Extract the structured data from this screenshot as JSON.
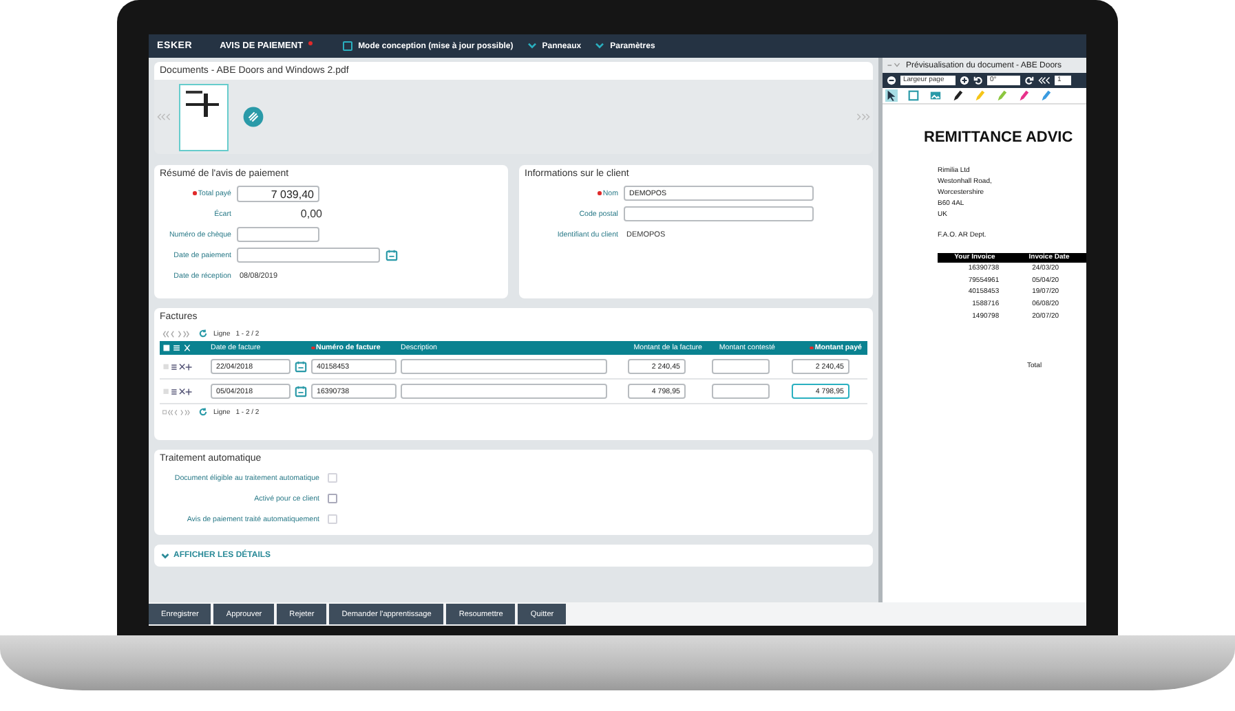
{
  "topbar": {
    "logo": "ESKER",
    "title": "AVIS DE PAIEMENT",
    "required": true,
    "design_mode": {
      "label": "Mode conception (mise à jour possible)",
      "checked": false
    },
    "menus": [
      {
        "label": "Panneaux"
      },
      {
        "label": "Paramètres"
      }
    ]
  },
  "documents": {
    "title": "Documents - ABE Doors and Windows 2.pdf"
  },
  "summary": {
    "title": "Résumé de l'avis de paiement",
    "fields": [
      {
        "kind": "amount",
        "label": "Total payé",
        "required": true,
        "value": "7 039,40"
      },
      {
        "kind": "total",
        "label": "Écart",
        "value": "0,00"
      },
      {
        "kind": "input",
        "label": "Numéro de chèque",
        "required": false
      },
      {
        "kind": "date",
        "label": "Date de paiement",
        "required": false
      },
      {
        "kind": "text",
        "label": "Date de réception",
        "value": "08/08/2019"
      }
    ]
  },
  "client": {
    "title": "Informations sur le client",
    "fields": [
      {
        "kind": "input",
        "label": "Nom",
        "required": true,
        "value": "DEMOPOS"
      },
      {
        "kind": "input",
        "label": "Code postal",
        "required": false
      },
      {
        "kind": "text",
        "label": "Identifiant du client",
        "value": "DEMOPOS"
      }
    ]
  },
  "invoices": {
    "title": "Factures",
    "pager_top": {
      "label": "Ligne",
      "range": "1 - 2 / 2"
    },
    "columns": [
      {
        "label": "Date de facture",
        "required": false
      },
      {
        "label": "Numéro de facture",
        "required": true
      },
      {
        "label": "Description",
        "required": false
      },
      {
        "label": "Montant de la facture",
        "required": false
      },
      {
        "label": "Montant contesté",
        "required": false
      },
      {
        "label": "Montant payé",
        "required": true
      }
    ],
    "rows": [
      {
        "date": "22/04/2018",
        "number": "40158453",
        "amount": "2 240,45",
        "paid": "2 240,45",
        "focused": false
      },
      {
        "date": "05/04/2018",
        "number": "16390738",
        "amount": "4 798,95",
        "paid": "4 798,95",
        "focused": true
      }
    ],
    "pager_bottom": {
      "label": "Ligne",
      "range": "1 - 2 / 2"
    }
  },
  "auto": {
    "title": "Traitement automatique",
    "options": [
      {
        "label": "Document éligible au traitement automatique",
        "checked": false,
        "disabled": true
      },
      {
        "label": "Activé pour ce client",
        "checked": false,
        "disabled": false
      },
      {
        "label": "Avis de paiement traité automatiquement",
        "checked": false,
        "disabled": true
      }
    ]
  },
  "details": {
    "label": "AFFICHER LES DÉTAILS",
    "expanded": false
  },
  "actions": [
    "Enregistrer",
    "Approuver",
    "Rejeter",
    "Demander l'apprentissage",
    "Resoumettre",
    "Quitter"
  ],
  "preview": {
    "title": "Prévisualisation du document - ABE Doors",
    "zoom": "Largeur page",
    "rotation": "0°",
    "page": "1",
    "tools": [
      {
        "kind": "pointer",
        "selected": true
      },
      {
        "kind": "note",
        "selected": false
      },
      {
        "kind": "image",
        "selected": false
      },
      {
        "kind": "pen",
        "color": "#222222",
        "selected": false
      },
      {
        "kind": "pen",
        "color": "#f5c518",
        "selected": false
      },
      {
        "kind": "pen",
        "color": "#8cc63f",
        "selected": false
      },
      {
        "kind": "pen",
        "color": "#e8308a",
        "selected": false
      },
      {
        "kind": "pen",
        "color": "#3a9be0",
        "selected": false
      }
    ],
    "doc_title": "REMITTANCE ADVIC",
    "address": [
      "Rimilia Ltd",
      "Westonhall Road,",
      "Worcestershire",
      "B60 4AL",
      "UK"
    ],
    "fao": "F.A.O. AR Dept.",
    "table_head": [
      "Your Invoice",
      "Invoice Date"
    ],
    "table_rows": [
      [
        "16390738",
        "24/03/20"
      ],
      [
        "79554961",
        "05/04/20"
      ],
      [
        "40158453",
        "19/07/20"
      ],
      [
        "1588716",
        "06/08/20"
      ],
      [
        "1490798",
        "20/07/20"
      ]
    ],
    "total": "Total"
  }
}
